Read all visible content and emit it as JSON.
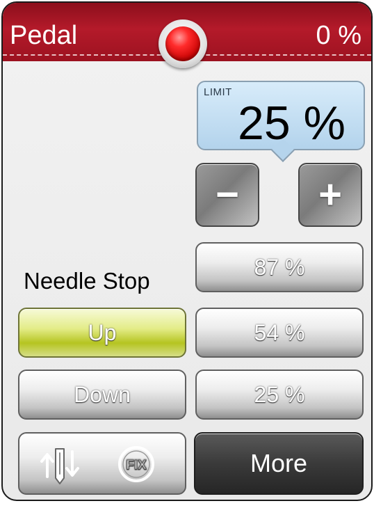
{
  "header": {
    "title": "Pedal",
    "value": "0 %",
    "indicator_color": "#e00000",
    "bar_color": "#a8151f"
  },
  "limit": {
    "label": "LIMIT",
    "value": "25 %",
    "box_color": "#bcd9ef"
  },
  "controls": {
    "decrease_icon": "minus-icon",
    "increase_icon": "plus-icon",
    "decrease_glyph": "−",
    "increase_glyph": "+"
  },
  "needle_stop": {
    "label": "Needle Stop",
    "up_label": "Up",
    "down_label": "Down",
    "active": "Up",
    "active_color": "#c4d12a"
  },
  "presets": [
    "87 %",
    "54 %",
    "25 %"
  ],
  "bottom": {
    "icons": [
      "needle-up-down-icon",
      "fix-icon"
    ],
    "fix_text": "FIX",
    "more_label": "More"
  }
}
